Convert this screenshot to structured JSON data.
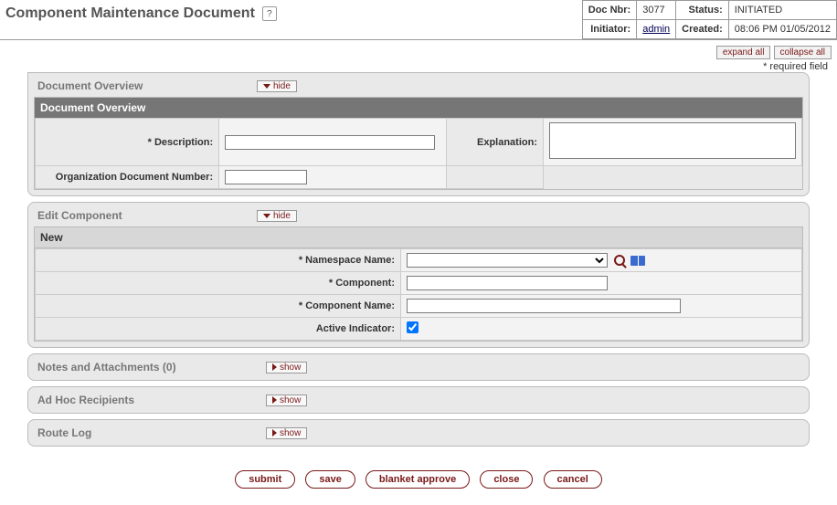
{
  "title": "Component Maintenance Document",
  "header": {
    "docNbrLabel": "Doc Nbr:",
    "docNbr": "3077",
    "statusLabel": "Status:",
    "status": "INITIATED",
    "initiatorLabel": "Initiator:",
    "initiator": "admin",
    "createdLabel": "Created:",
    "created": "08:06 PM 01/05/2012"
  },
  "util": {
    "expandAll": "expand all",
    "collapseAll": "collapse all",
    "requiredNote": "* required field"
  },
  "toggle": {
    "hide": "hide",
    "show": "show"
  },
  "docOverview": {
    "sectionTitle": "Document Overview",
    "panelTitle": "Document Overview",
    "descriptionLabel": "* Description:",
    "orgDocNumLabel": "Organization Document Number:",
    "explanationLabel": "Explanation:"
  },
  "editComponent": {
    "sectionTitle": "Edit Component",
    "panelTitle": "New",
    "namespaceLabel": "* Namespace Name:",
    "componentLabel": "* Component:",
    "componentNameLabel": "* Component Name:",
    "activeIndicatorLabel": "Active Indicator:"
  },
  "sections": {
    "notes": "Notes and Attachments (0)",
    "adhoc": "Ad Hoc Recipients",
    "routeLog": "Route Log"
  },
  "actions": {
    "submit": "submit",
    "save": "save",
    "blanketApprove": "blanket approve",
    "close": "close",
    "cancel": "cancel"
  }
}
